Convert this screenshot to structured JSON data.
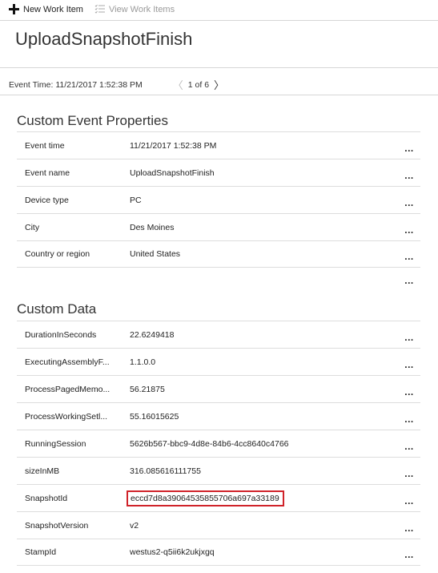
{
  "toolbar": {
    "new_work_item": "New Work Item",
    "view_work_items": "View Work Items"
  },
  "header": {
    "title": "UploadSnapshotFinish",
    "event_time_label": "Event Time: 11/21/2017 1:52:38 PM",
    "pager_text": "1 of 6",
    "prev_glyph": "〈",
    "next_glyph": "〉"
  },
  "custom_event_properties": {
    "title": "Custom Event Properties",
    "rows": [
      {
        "key": "Event time",
        "value": "11/21/2017 1:52:38 PM"
      },
      {
        "key": "Event name",
        "value": "UploadSnapshotFinish"
      },
      {
        "key": "Device type",
        "value": "PC"
      },
      {
        "key": "City",
        "value": "Des Moines"
      },
      {
        "key": "Country or region",
        "value": "United States"
      }
    ]
  },
  "custom_data": {
    "title": "Custom Data",
    "rows": [
      {
        "key": "DurationInSeconds",
        "value": "22.6249418"
      },
      {
        "key": "ExecutingAssemblyF...",
        "value": "1.1.0.0"
      },
      {
        "key": "ProcessPagedMemo...",
        "value": "56.21875"
      },
      {
        "key": "ProcessWorkingSetl...",
        "value": "55.16015625"
      },
      {
        "key": "RunningSession",
        "value": "5626b567-bbc9-4d8e-84b6-4cc8640c4766"
      },
      {
        "key": "sizeInMB",
        "value": "316.085616111755"
      },
      {
        "key": "SnapshotId",
        "value": "eccd7d8a39064535855706a697a33189"
      },
      {
        "key": "SnapshotVersion",
        "value": "v2"
      },
      {
        "key": "StampId",
        "value": "westus2-q5ii6k2ukjxgq"
      }
    ]
  },
  "more_glyph": "...",
  "colors": {
    "highlight_border": "#d0232a",
    "divider": "#d6d6d6",
    "disabled_text": "#9a9a9a"
  }
}
